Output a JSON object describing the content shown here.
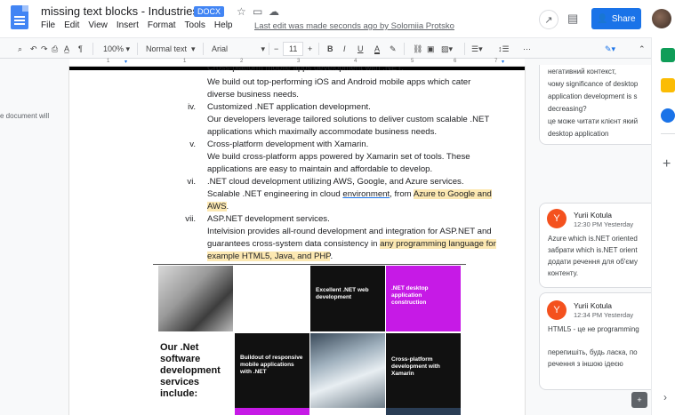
{
  "header": {
    "title": "missing text blocks - Industries",
    "badge": "DOCX",
    "menu": [
      "File",
      "Edit",
      "View",
      "Insert",
      "Format",
      "Tools",
      "Help"
    ],
    "last_edit": "Last edit was made seconds ago by Solomiia Protsko",
    "share_label": "Share"
  },
  "toolbar": {
    "zoom": "100%",
    "style": "Normal text",
    "font": "Arial",
    "font_size": "11",
    "bold": "B",
    "italic": "I",
    "underline": "U",
    "text_color": "A",
    "more": "⋯"
  },
  "ruler": [
    "1",
    "1",
    "2",
    "3",
    "4",
    "5",
    "6",
    "7"
  ],
  "left_note": "e document will",
  "list": [
    {
      "num": "",
      "lines": [
        "Cross-platform mobile apps development with .NET."
      ]
    },
    {
      "num": "",
      "lines": [
        "We build out top-performing iOS and Android mobile apps which cater",
        "diverse business needs."
      ]
    },
    {
      "num": "iv.",
      "lines": [
        "Customized .NET application development."
      ]
    },
    {
      "num": "",
      "lines": [
        "Our developers leverage tailored solutions to deliver custom scalable .NET",
        "applications which maximally accommodate business needs."
      ]
    },
    {
      "num": "v.",
      "lines": [
        "Cross-platform development with Xamarin."
      ]
    },
    {
      "num": "",
      "lines": [
        "We build cross-platform apps powered by Xamarin set of tools. These",
        "applications are easy to maintain and affordable to develop."
      ]
    },
    {
      "num": "vi.",
      "lines": [
        ".NET cloud development utilizing AWS, Google, and Azure services."
      ]
    }
  ],
  "item_vi_text": {
    "a": "Scalable .NET engineering in cloud ",
    "b": "environment",
    "c": ", from ",
    "d": "Azure to Google and",
    "e": "AWS",
    "f": "."
  },
  "item_vii": {
    "num": "vii.",
    "title": "ASP.NET development services.",
    "line1": "Intelvision provides all-round development and integration for ASP.NET and",
    "line2a": "guarantees cross-system data consistency in ",
    "line2b": "any programming language for",
    "line3": "example HTML5, Java, and PHP",
    "line3_end": "."
  },
  "figure": {
    "heading": [
      "Our .Net",
      "software",
      "development",
      "services",
      "include:"
    ],
    "cells": [
      "Excellent .NET web development",
      ".NET desktop application construction",
      "Buildout of responsive mobile applications with .NET",
      "Cross-platform development with Xamarin"
    ],
    "colors": {
      "purple": "#c61ae6",
      "black": "#111111"
    }
  },
  "comments": {
    "top_card": {
      "lines": [
        "негативний контекст,",
        "чому significance of desktop",
        "application development is s",
        "decreasing?",
        "це може читати клієнт який",
        "desktop application"
      ]
    },
    "card1": {
      "initial": "Y",
      "name": "Yurii Kotula",
      "time": "12:30 PM Yesterday",
      "lines": [
        "Azure which is.NET oriented",
        "забрати which is.NET orient",
        "додати речення для об'єму",
        "контенту."
      ]
    },
    "card2": {
      "initial": "Y",
      "name": "Yurii Kotula",
      "time": "12:34 PM Yesterday",
      "lines": [
        "HTML5 - це не programming",
        "",
        "перепишіть, будь ласка, по",
        "речення з іншою ідеєю"
      ]
    }
  },
  "colors": {
    "accent": "#1a73e8",
    "highlight": "#fce8b2",
    "avatar": "#f4511e"
  }
}
